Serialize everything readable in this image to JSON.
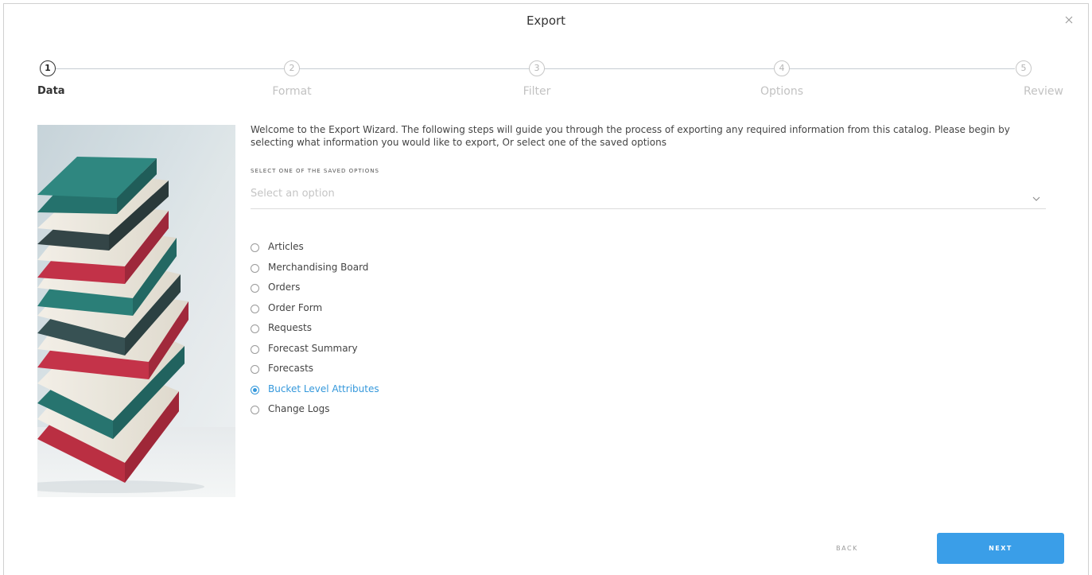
{
  "dialog": {
    "title": "Export",
    "close_icon": "close-icon"
  },
  "steps": [
    {
      "number": "1",
      "label": "Data",
      "state": "active"
    },
    {
      "number": "2",
      "label": "Format",
      "state": "inactive"
    },
    {
      "number": "3",
      "label": "Filter",
      "state": "inactive"
    },
    {
      "number": "4",
      "label": "Options",
      "state": "inactive"
    },
    {
      "number": "5",
      "label": "Review",
      "state": "inactive"
    }
  ],
  "welcome_text": "Welcome to the Export Wizard. The following steps will guide you through the process of exporting any required information from this catalog. Please begin by selecting what information you would like to export, Or select one of the saved options",
  "saved_options": {
    "label": "SELECT ONE OF THE SAVED OPTIONS",
    "placeholder": "Select an option",
    "chevron_icon": "chevron-down-icon"
  },
  "export_types": [
    {
      "label": "Articles",
      "selected": false
    },
    {
      "label": "Merchandising Board",
      "selected": false
    },
    {
      "label": "Orders",
      "selected": false
    },
    {
      "label": "Order Form",
      "selected": false
    },
    {
      "label": "Requests",
      "selected": false
    },
    {
      "label": "Forecast Summary",
      "selected": false
    },
    {
      "label": "Forecasts",
      "selected": false
    },
    {
      "label": "Bucket Level Attributes",
      "selected": true
    },
    {
      "label": "Change Logs",
      "selected": false
    }
  ],
  "footer": {
    "back_label": "BACK",
    "next_label": "NEXT"
  },
  "colors": {
    "accent": "#3a9ee8",
    "selected_text": "#3598db"
  }
}
